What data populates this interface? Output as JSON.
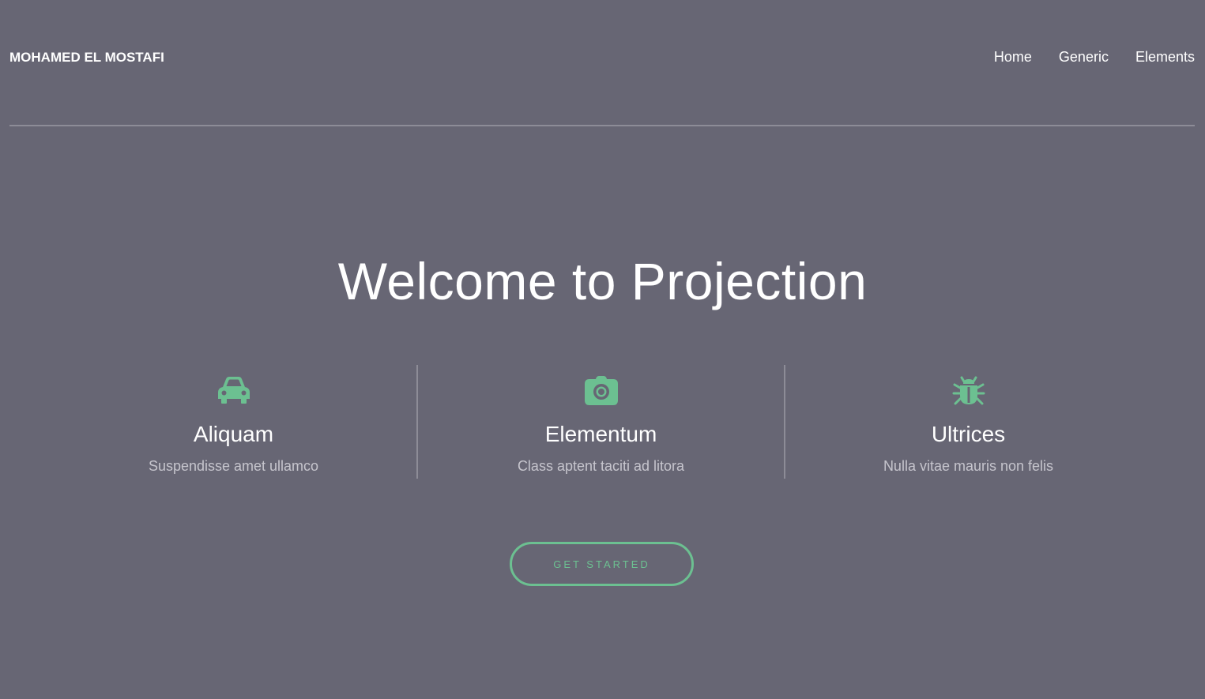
{
  "header": {
    "brand": "MOHAMED EL MOSTAFI",
    "nav": [
      {
        "label": "Home"
      },
      {
        "label": "Generic"
      },
      {
        "label": "Elements"
      }
    ]
  },
  "hero": {
    "title": "Welcome to Projection"
  },
  "features": [
    {
      "icon": "car-icon",
      "title": "Aliquam",
      "description": "Suspendisse amet ullamco"
    },
    {
      "icon": "camera-icon",
      "title": "Elementum",
      "description": "Class aptent taciti ad litora"
    },
    {
      "icon": "bug-icon",
      "title": "Ultrices",
      "description": "Nulla vitae mauris non felis"
    }
  ],
  "cta": {
    "label": "GET STARTED"
  },
  "colors": {
    "background": "#676674",
    "accent": "#6cc091",
    "divider": "#8d8c97",
    "text": "#ffffff",
    "muted_text": "#c6c5cd"
  }
}
